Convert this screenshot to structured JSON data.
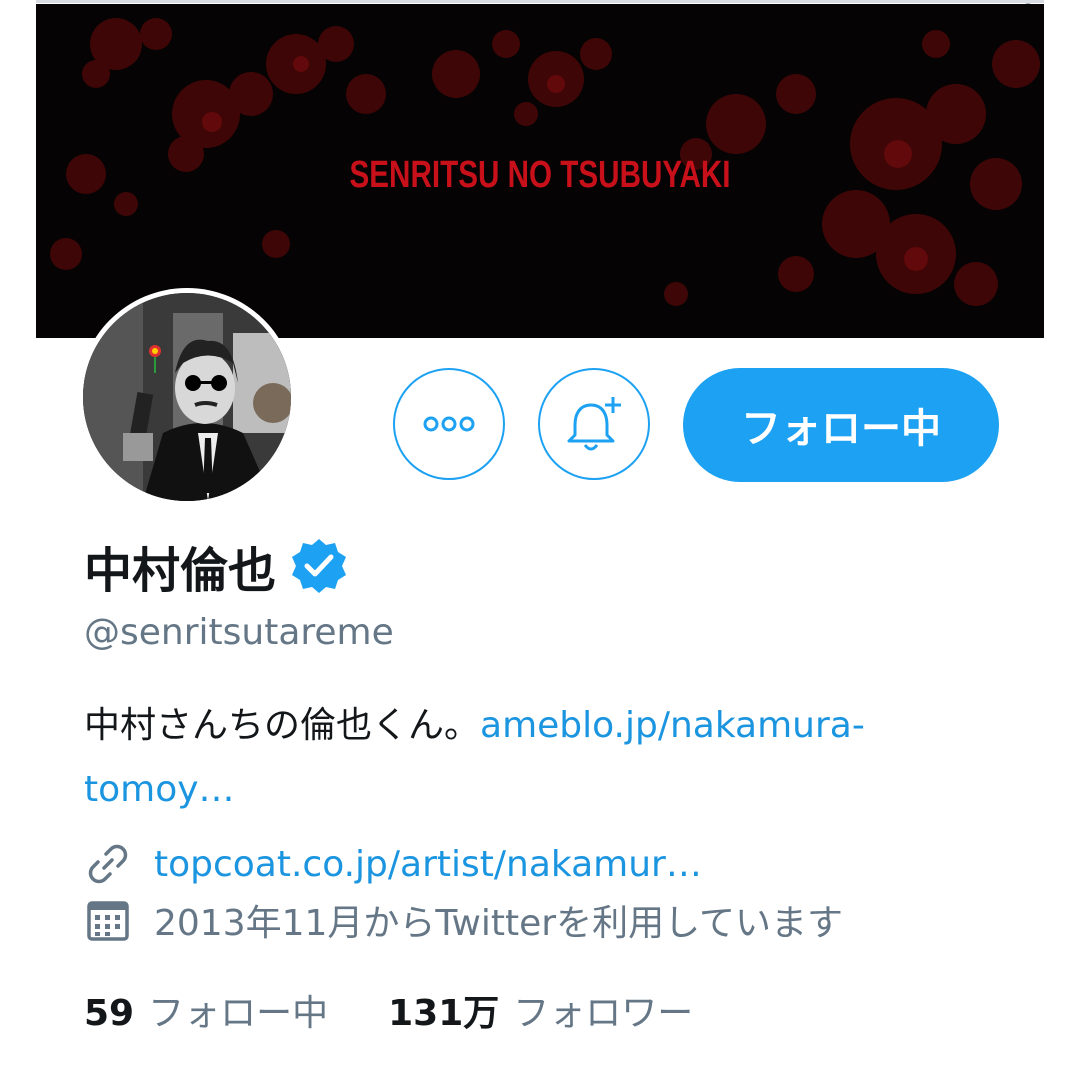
{
  "banner": {
    "title": "SENRITSU NO TSUBUYAKI"
  },
  "actions": {
    "more_icon": "more-horizontal-icon",
    "notify_icon": "bell-plus-icon",
    "follow_label": "フォロー中"
  },
  "profile": {
    "name": "中村倫也",
    "verified_icon": "verified-badge-icon",
    "handle": "@senritsutareme",
    "bio_text": "中村さんちの倫也くん。",
    "bio_link_line1": "ameblo.jp/nakamura-",
    "bio_link_line2": "tomoy…",
    "website": "topcoat.co.jp/artist/nakamur…",
    "joined": "2013年11月からTwitterを利用しています"
  },
  "stats": {
    "following_count": "59",
    "following_label": "フォロー中",
    "followers_count": "131万",
    "followers_label": "フォロワー"
  },
  "colors": {
    "accent": "#1da1f2",
    "link": "#1b95e0",
    "secondary_text": "#657786",
    "banner_title": "#c8101a"
  }
}
